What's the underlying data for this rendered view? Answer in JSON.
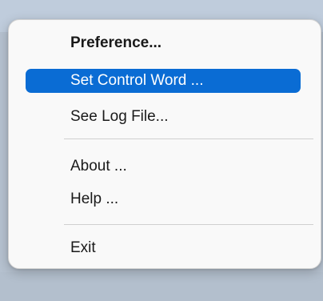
{
  "menu": {
    "items": [
      {
        "label": "Preference...",
        "bold": true,
        "highlighted": false
      },
      {
        "label": "Set Control Word ...",
        "bold": false,
        "highlighted": true
      },
      {
        "label": "See Log File...",
        "bold": false,
        "highlighted": false
      },
      {
        "label": "About ...",
        "bold": false,
        "highlighted": false
      },
      {
        "label": "Help ...",
        "bold": false,
        "highlighted": false
      },
      {
        "label": "Exit",
        "bold": false,
        "highlighted": false
      }
    ]
  },
  "colors": {
    "highlight": "#0a6cd4",
    "menu_background": "#f9f9f9",
    "text": "#1a1a1a"
  }
}
